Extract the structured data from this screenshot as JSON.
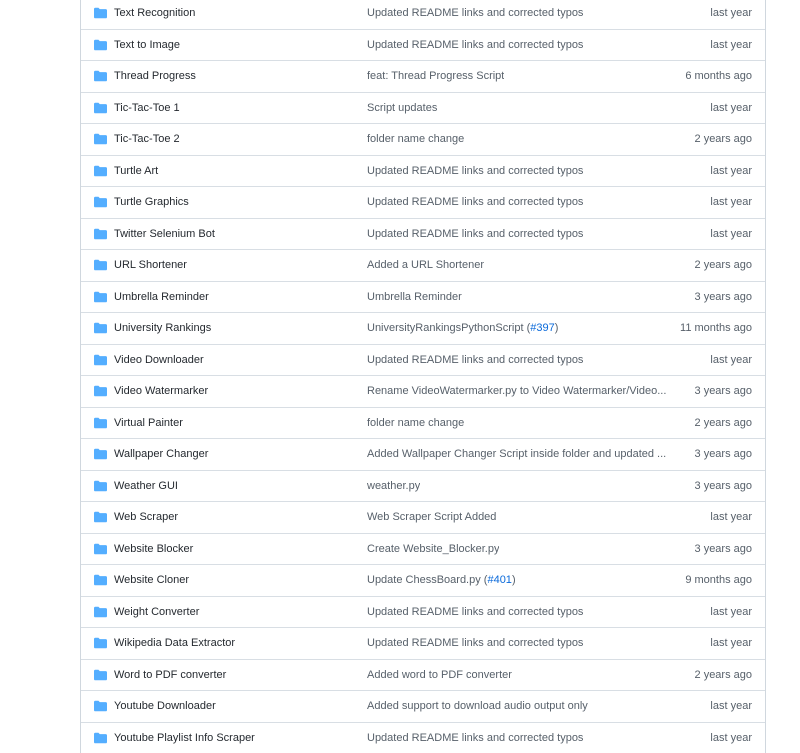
{
  "colors": {
    "folder": "#54aeff",
    "link": "#0969da",
    "muted": "#57606a",
    "border": "#d0d7de"
  },
  "rows": [
    {
      "name": "Text Recognition",
      "message": "Updated README links and corrected typos",
      "age": "last year"
    },
    {
      "name": "Text to Image",
      "message": "Updated README links and corrected typos",
      "age": "last year"
    },
    {
      "name": "Thread Progress",
      "message": "feat: Thread Progress Script",
      "age": "6 months ago"
    },
    {
      "name": "Tic-Tac-Toe 1",
      "message": "Script updates",
      "age": "last year"
    },
    {
      "name": "Tic-Tac-Toe 2",
      "message": "folder name change",
      "age": "2 years ago"
    },
    {
      "name": "Turtle Art",
      "message": "Updated README links and corrected typos",
      "age": "last year"
    },
    {
      "name": "Turtle Graphics",
      "message": "Updated README links and corrected typos",
      "age": "last year"
    },
    {
      "name": "Twitter Selenium Bot",
      "message": "Updated README links and corrected typos",
      "age": "last year"
    },
    {
      "name": "URL Shortener",
      "message": "Added a URL Shortener",
      "age": "2 years ago"
    },
    {
      "name": "Umbrella Reminder",
      "message": "Umbrella Reminder",
      "age": "3 years ago"
    },
    {
      "name": "University Rankings",
      "message": "UniversityRankingsPythonScript (",
      "pr": "#397",
      "suffix": ")",
      "age": "11 months ago"
    },
    {
      "name": "Video Downloader",
      "message": "Updated README links and corrected typos",
      "age": "last year"
    },
    {
      "name": "Video Watermarker",
      "message": "Rename VideoWatermarker.py to Video Watermarker/Video...",
      "age": "3 years ago"
    },
    {
      "name": "Virtual Painter",
      "message": "folder name change",
      "age": "2 years ago"
    },
    {
      "name": "Wallpaper Changer",
      "message": "Added Wallpaper Changer Script inside folder and updated ...",
      "age": "3 years ago"
    },
    {
      "name": "Weather GUI",
      "message": "weather.py",
      "age": "3 years ago"
    },
    {
      "name": "Web Scraper",
      "message": "Web Scraper Script Added",
      "age": "last year"
    },
    {
      "name": "Website Blocker",
      "message": "Create Website_Blocker.py",
      "age": "3 years ago"
    },
    {
      "name": "Website Cloner",
      "message": "Update ChessBoard.py (",
      "pr": "#401",
      "suffix": ")",
      "age": "9 months ago"
    },
    {
      "name": "Weight Converter",
      "message": "Updated README links and corrected typos",
      "age": "last year"
    },
    {
      "name": "Wikipedia Data Extractor",
      "message": "Updated README links and corrected typos",
      "age": "last year"
    },
    {
      "name": "Word to PDF converter",
      "message": "Added word to PDF converter",
      "age": "2 years ago"
    },
    {
      "name": "Youtube Downloader",
      "message": "Added support to download audio output only",
      "age": "last year"
    },
    {
      "name": "Youtube Playlist Info Scraper",
      "message": "Updated README links and corrected typos",
      "age": "last year"
    }
  ]
}
